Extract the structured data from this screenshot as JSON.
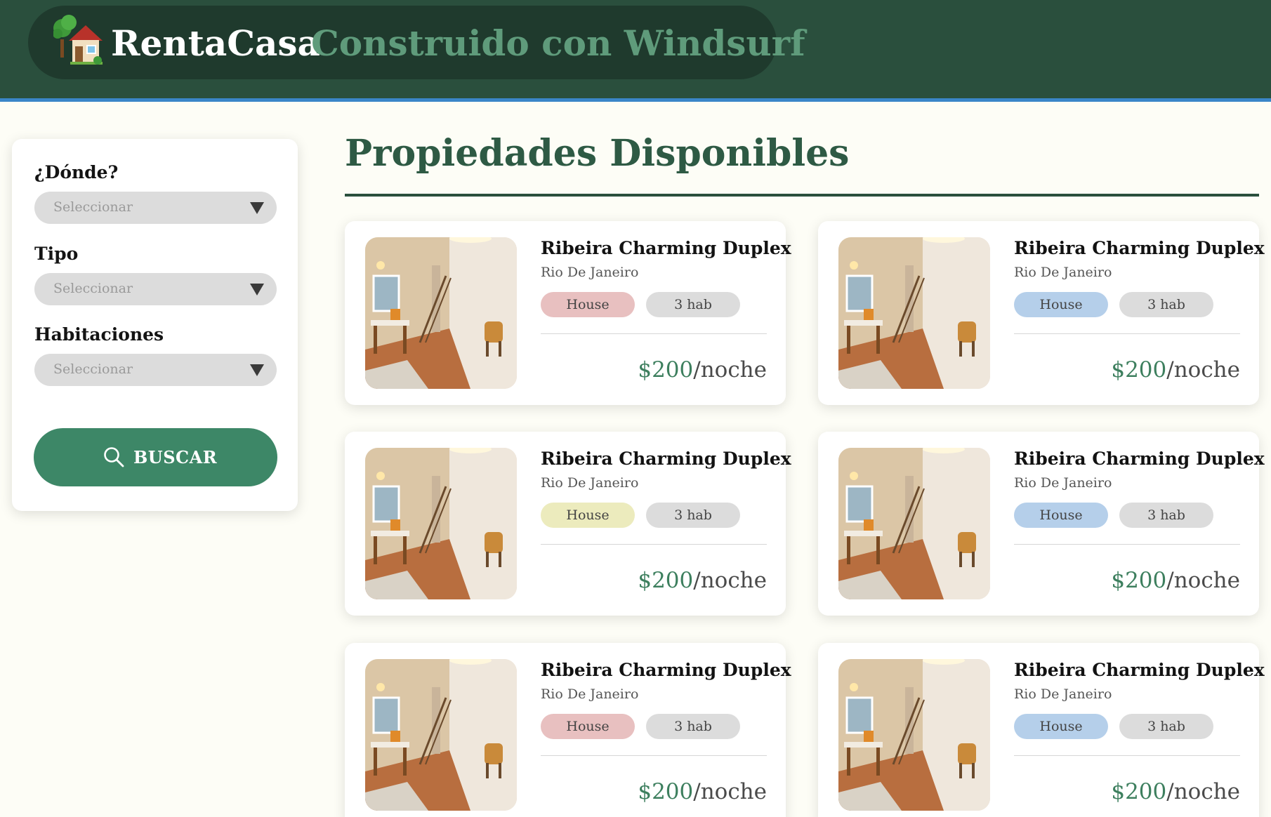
{
  "header": {
    "logo_icon": "house-with-tree-icon",
    "brand_name": "RentaCasa",
    "tagline": "Construido con Windsurf",
    "colors": {
      "bar": "#2a4f3d",
      "pill": "#1f3a2d",
      "accent_line": "#3a86c8"
    }
  },
  "filters": {
    "where": {
      "label": "¿Dónde?",
      "placeholder": "Seleccionar"
    },
    "type": {
      "label": "Tipo",
      "placeholder": "Seleccionar"
    },
    "rooms": {
      "label": "Habitaciones",
      "placeholder": "Seleccionar"
    },
    "search_button": {
      "label": "BUSCAR",
      "icon": "search-icon",
      "color": "#3d8767"
    }
  },
  "main": {
    "title": "Propiedades Disponibles",
    "listings": [
      {
        "title": "Ribeira Charming Duplex",
        "location": "Rio De Janeiro",
        "type": "House",
        "type_color": "pink",
        "rooms": "3 hab",
        "price": "$200",
        "price_unit": "/noche"
      },
      {
        "title": "Ribeira Charming Duplex",
        "location": "Rio De Janeiro",
        "type": "House",
        "type_color": "blue",
        "rooms": "3 hab",
        "price": "$200",
        "price_unit": "/noche"
      },
      {
        "title": "Ribeira Charming Duplex",
        "location": "Rio De Janeiro",
        "type": "House",
        "type_color": "yellow",
        "rooms": "3 hab",
        "price": "$200",
        "price_unit": "/noche"
      },
      {
        "title": "Ribeira Charming Duplex",
        "location": "Rio De Janeiro",
        "type": "House",
        "type_color": "blue",
        "rooms": "3 hab",
        "price": "$200",
        "price_unit": "/noche"
      },
      {
        "title": "Ribeira Charming Duplex",
        "location": "Rio De Janeiro",
        "type": "House",
        "type_color": "pink",
        "rooms": "3 hab",
        "price": "$200",
        "price_unit": "/noche"
      },
      {
        "title": "Ribeira Charming Duplex",
        "location": "Rio De Janeiro",
        "type": "House",
        "type_color": "blue",
        "rooms": "3 hab",
        "price": "$200",
        "price_unit": "/noche"
      }
    ]
  }
}
